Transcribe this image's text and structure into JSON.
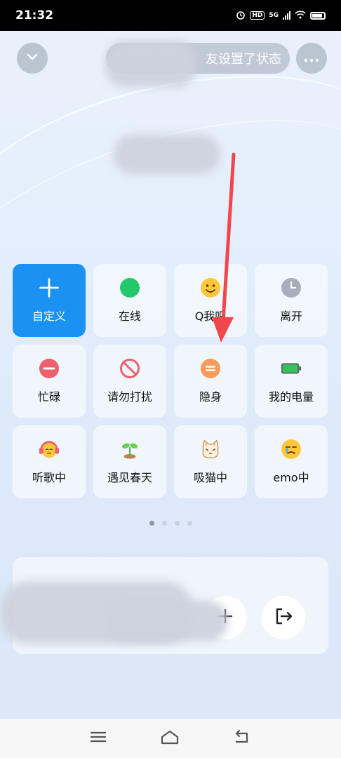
{
  "status_bar": {
    "time": "21:32",
    "network_label": "5G",
    "hd_label": "HD"
  },
  "header": {
    "status_text": "友设置了状态"
  },
  "status_grid": [
    {
      "label": "自定义",
      "icon": "plus-icon"
    },
    {
      "label": "在线",
      "icon": "online-dot-icon"
    },
    {
      "label": "Q我吧",
      "icon": "smile-icon"
    },
    {
      "label": "离开",
      "icon": "clock-icon"
    },
    {
      "label": "忙碌",
      "icon": "busy-icon"
    },
    {
      "label": "请勿打扰",
      "icon": "no-disturb-icon"
    },
    {
      "label": "隐身",
      "icon": "invisible-icon"
    },
    {
      "label": "我的电量",
      "icon": "battery-icon"
    },
    {
      "label": "听歌中",
      "icon": "headphones-face-icon"
    },
    {
      "label": "遇见春天",
      "icon": "sprout-icon"
    },
    {
      "label": "吸猫中",
      "icon": "cat-icon"
    },
    {
      "label": "emo中",
      "icon": "sad-face-icon"
    }
  ],
  "pager": {
    "pages": 4,
    "current": 1
  },
  "colors": {
    "primary": "#1a92f4",
    "online": "#22c96b",
    "busy": "#ef5f6e",
    "invisible": "#f79a5a",
    "arrow": "#f0474d"
  }
}
